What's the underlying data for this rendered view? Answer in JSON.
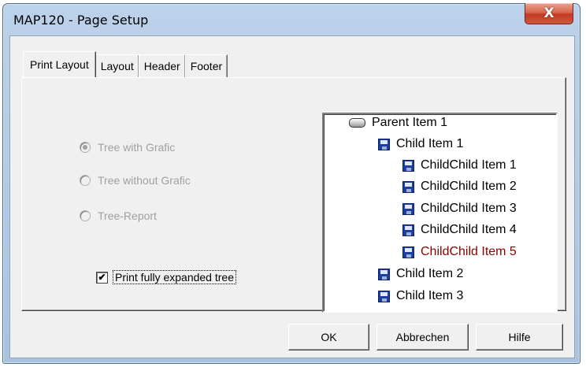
{
  "window": {
    "title": "MAP120 - Page Setup",
    "close_glyph": "X"
  },
  "tabs": [
    {
      "label": "Print Layout",
      "active": true
    },
    {
      "label": "Layout",
      "active": false
    },
    {
      "label": "Header",
      "active": false
    },
    {
      "label": "Footer",
      "active": false
    }
  ],
  "print_mode": {
    "options": [
      {
        "label": "Tree with Grafic",
        "selected": true,
        "enabled": false
      },
      {
        "label": "Tree without Grafic",
        "selected": false,
        "enabled": false
      },
      {
        "label": "Tree-Report",
        "selected": false,
        "enabled": false
      }
    ]
  },
  "expanded_checkbox": {
    "label": "Print fully expanded tree",
    "checked": true,
    "mark": "✔"
  },
  "tree": {
    "items": [
      {
        "label": "Parent Item 1",
        "icon": "parent-icon",
        "level": 0
      },
      {
        "label": "Child Item 1",
        "icon": "disk-icon",
        "level": 1
      },
      {
        "label": "ChildChild Item 1",
        "icon": "disk-icon",
        "level": 2
      },
      {
        "label": "ChildChild Item 2",
        "icon": "disk-icon",
        "level": 2
      },
      {
        "label": "ChildChild Item 3",
        "icon": "disk-icon",
        "level": 2
      },
      {
        "label": "ChildChild Item 4",
        "icon": "disk-icon",
        "level": 2
      },
      {
        "label": "ChildChild Item 5",
        "icon": "disk-icon",
        "level": 2,
        "highlighted": true
      },
      {
        "label": "Child Item 2",
        "icon": "disk-icon",
        "level": 1
      },
      {
        "label": "Child Item 3",
        "icon": "disk-icon",
        "level": 1
      }
    ]
  },
  "buttons": {
    "ok": "OK",
    "cancel": "Abbrechen",
    "help": "Hilfe"
  },
  "colors": {
    "highlighted_item": "#8b0000",
    "disabled_text": "#a0a0a0"
  }
}
